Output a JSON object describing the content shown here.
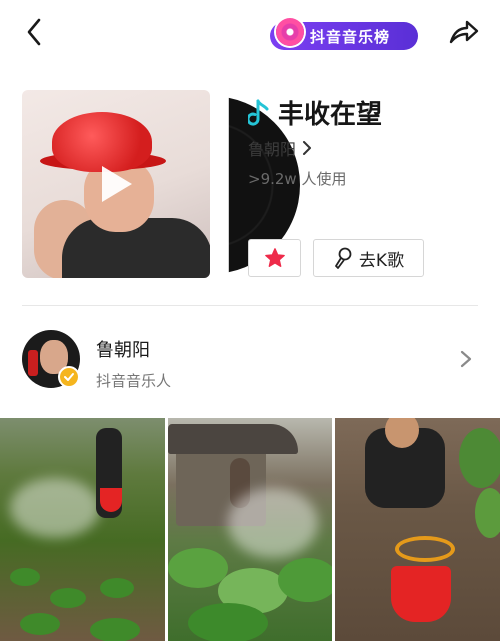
{
  "topbar": {
    "chart_badge_label": "抖音音乐榜",
    "back_icon": "chevron-left-icon",
    "share_icon": "share-arrow-icon"
  },
  "song": {
    "title": "丰收在望",
    "artist": "鲁朝阳",
    "usage": ">9.2w 人使用",
    "note_icon": "music-note-icon",
    "note_color": "#25c4d6"
  },
  "actions": {
    "favorite_icon": "star-icon",
    "favorite_color": "#ee2b4a",
    "karaoke_icon": "microphone-icon",
    "karaoke_label": "去K歌"
  },
  "artist_card": {
    "name": "鲁朝阳",
    "role": "抖音音乐人",
    "verified_color": "#f5b51e"
  },
  "videos": [
    {
      "scene": "vegetable-field-spraying"
    },
    {
      "scene": "stone-house-spraying"
    },
    {
      "scene": "man-with-red-bucket"
    }
  ],
  "colors": {
    "chart_pill_start": "#7b3ff2",
    "chart_pill_end": "#5a2fd6"
  }
}
